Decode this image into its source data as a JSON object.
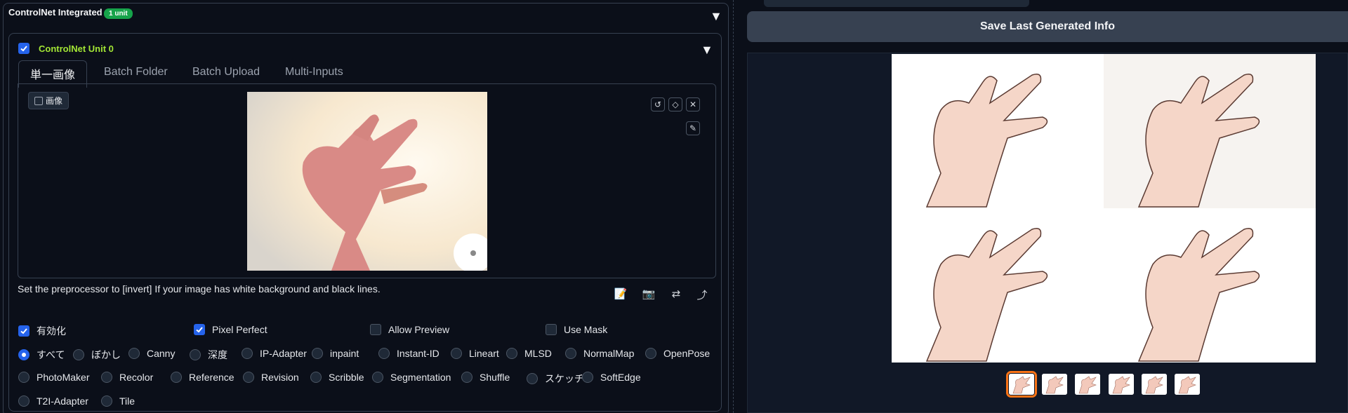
{
  "accordion": {
    "title": "ControlNet Integrated",
    "badge": "1 unit"
  },
  "unit": {
    "title": "ControlNet Unit 0",
    "enabled": true
  },
  "tabs": [
    {
      "label": "単一画像",
      "active": true
    },
    {
      "label": "Batch Folder",
      "active": false
    },
    {
      "label": "Batch Upload",
      "active": false
    },
    {
      "label": "Multi-Inputs",
      "active": false
    }
  ],
  "image_input": {
    "label": "画像"
  },
  "hint": "Set the preprocessor to [invert] If your image has white background and black lines.",
  "checkboxes": [
    {
      "label": "有効化",
      "checked": true
    },
    {
      "label": "Pixel Perfect",
      "checked": true
    },
    {
      "label": "Allow Preview",
      "checked": false
    },
    {
      "label": "Use Mask",
      "checked": false
    }
  ],
  "control_types": {
    "selected": "すべて",
    "row1": [
      "すべて",
      "ぼかし",
      "Canny",
      "深度",
      "IP-Adapter",
      "inpaint",
      "Instant-ID",
      "Lineart",
      "MLSD",
      "NormalMap",
      "OpenPose"
    ],
    "row2": [
      "PhotoMaker",
      "Recolor",
      "Reference",
      "Revision",
      "Scribble",
      "Segmentation",
      "Shuffle",
      "スケッチ",
      "SoftEdge"
    ],
    "row3": [
      "T2I-Adapter",
      "Tile"
    ]
  },
  "right": {
    "save_button": "Save Last Generated Info",
    "thumbnails_count": 6,
    "selected_thumbnail": 0
  },
  "colors": {
    "accent": "#2563eb",
    "unit_title": "#a3e635",
    "badge": "#16a34a",
    "selection": "#f97316"
  }
}
